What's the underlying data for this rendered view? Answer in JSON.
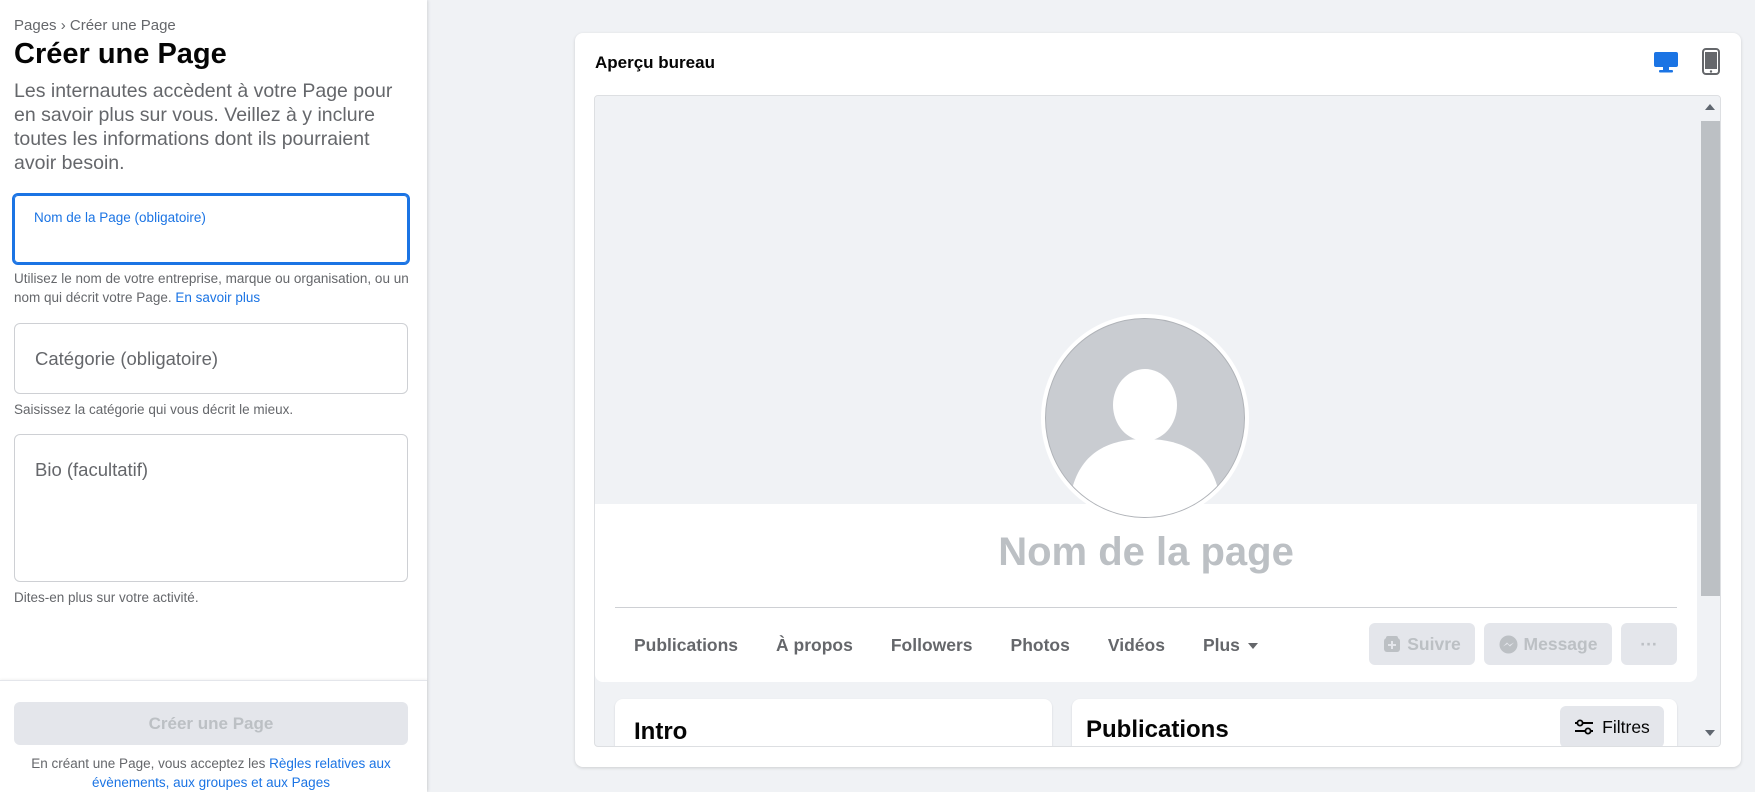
{
  "left": {
    "breadcrumb": "Pages › Créer une Page",
    "title": "Créer une Page",
    "intro": "Les internautes accèdent à votre Page pour en savoir plus sur vous. Veillez à y inclure toutes les informations dont ils pourraient avoir besoin.",
    "name_field": {
      "label": "Nom de la Page (obligatoire)",
      "value": "",
      "helper": "Utilisez le nom de votre entreprise, marque ou organisation, ou un nom qui décrit votre Page.",
      "helper_link": "En savoir plus"
    },
    "category_field": {
      "placeholder": "Catégorie (obligatoire)",
      "helper": "Saisissez la catégorie qui vous décrit le mieux."
    },
    "bio_field": {
      "placeholder": "Bio (facultatif)",
      "helper": "Dites-en plus sur votre activité."
    },
    "create_button": "Créer une Page",
    "terms_prefix": "En créant une Page, vous acceptez les",
    "terms_link": "Règles relatives aux évènements, aux groupes et aux Pages"
  },
  "preview": {
    "title": "Aperçu bureau",
    "page_name": "Nom de la page",
    "tabs": [
      "Publications",
      "À propos",
      "Followers",
      "Photos",
      "Vidéos",
      "Plus"
    ],
    "follow_button": "Suivre",
    "message_button": "Message",
    "more_button": "···",
    "intro_title": "Intro",
    "publications_title": "Publications",
    "filter_button": "Filtres"
  },
  "colors": {
    "accent": "#1b74e4",
    "disabled_text": "#bcc0c4",
    "secondary_text": "#65676b",
    "background": "#f0f2f5"
  },
  "icons": [
    "desktop-icon",
    "mobile-icon",
    "default-avatar-icon",
    "follow-icon",
    "messenger-icon",
    "filter-icon",
    "caret-down-icon",
    "scroll-up-arrow-icon",
    "scroll-down-arrow-icon"
  ]
}
